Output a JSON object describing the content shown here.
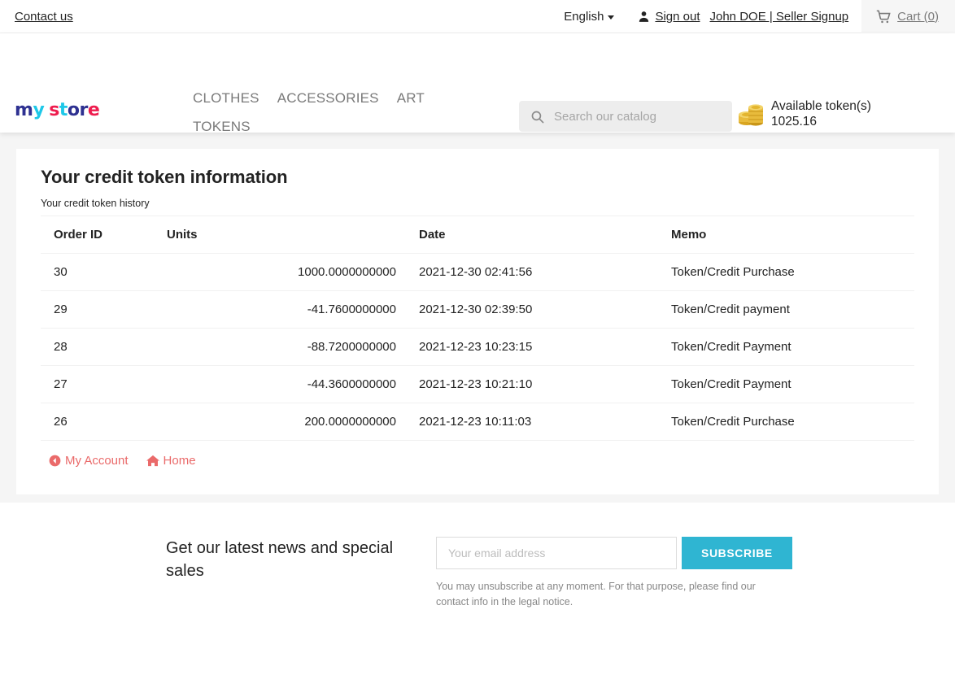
{
  "topnav": {
    "contact_label": "Contact us",
    "language": "English",
    "signout_label": "Sign out",
    "account_label": "John DOE | Seller Signup",
    "cart_label": "Cart (0)",
    "icons": {
      "user": "user-icon",
      "cart": "cart-icon",
      "caret": "chevron-down-icon"
    }
  },
  "header": {
    "logo": {
      "letters": [
        {
          "char": "m",
          "color": "#2e3191"
        },
        {
          "char": "y",
          "color": "#1ec8e8"
        },
        {
          "char": " ",
          "color": "#ffffff"
        },
        {
          "char": "s",
          "color": "#ee1c4e"
        },
        {
          "char": "t",
          "color": "#1ec8e8"
        },
        {
          "char": "o",
          "color": "#2e3191"
        },
        {
          "char": "r",
          "color": "#2e3191"
        },
        {
          "char": "e",
          "color": "#ee1c4e"
        }
      ],
      "alt": "my store"
    },
    "menu": [
      {
        "label": "CLOTHES"
      },
      {
        "label": "ACCESSORIES"
      },
      {
        "label": "ART"
      },
      {
        "label": "TOKENS"
      }
    ],
    "search": {
      "placeholder": "Search our catalog",
      "value": "",
      "icon": "search-icon"
    },
    "tokens": {
      "icon": "coins-icon",
      "label": "Available token(s)",
      "amount": "1025.16"
    }
  },
  "main": {
    "title": "Your credit token information",
    "subtitle": "Your credit token history",
    "table": {
      "columns": [
        "Order ID",
        "Units",
        "Date",
        "Memo"
      ],
      "rows": [
        {
          "order_id": "30",
          "units": "1000.0000000000",
          "date": "2021-12-30 02:41:56",
          "memo": "Token/Credit Purchase"
        },
        {
          "order_id": "29",
          "units": "-41.7600000000",
          "date": "2021-12-30 02:39:50",
          "memo": "Token/Credit payment"
        },
        {
          "order_id": "28",
          "units": "-88.7200000000",
          "date": "2021-12-23 10:23:15",
          "memo": "Token/Credit Payment"
        },
        {
          "order_id": "27",
          "units": "-44.3600000000",
          "date": "2021-12-23 10:21:10",
          "memo": "Token/Credit Payment"
        },
        {
          "order_id": "26",
          "units": "200.0000000000",
          "date": "2021-12-23 10:11:03",
          "memo": "Token/Credit Purchase"
        }
      ]
    },
    "footer_links": [
      {
        "label": "My Account",
        "icon": "arrow-circle-left-icon"
      },
      {
        "label": "Home",
        "icon": "home-icon"
      }
    ]
  },
  "newsletter": {
    "title": "Get our latest news and special sales",
    "email_placeholder": "Your email address",
    "email_value": "",
    "subscribe_label": "SUBSCRIBE",
    "note": "You may unsubscribe at any moment. For that purpose, please find our contact info in the legal notice."
  },
  "colors": {
    "accent": "#2fb5d2",
    "link": "#ea6a6a",
    "page_bg": "#f5f5f5",
    "muted": "#7a7a7a"
  }
}
